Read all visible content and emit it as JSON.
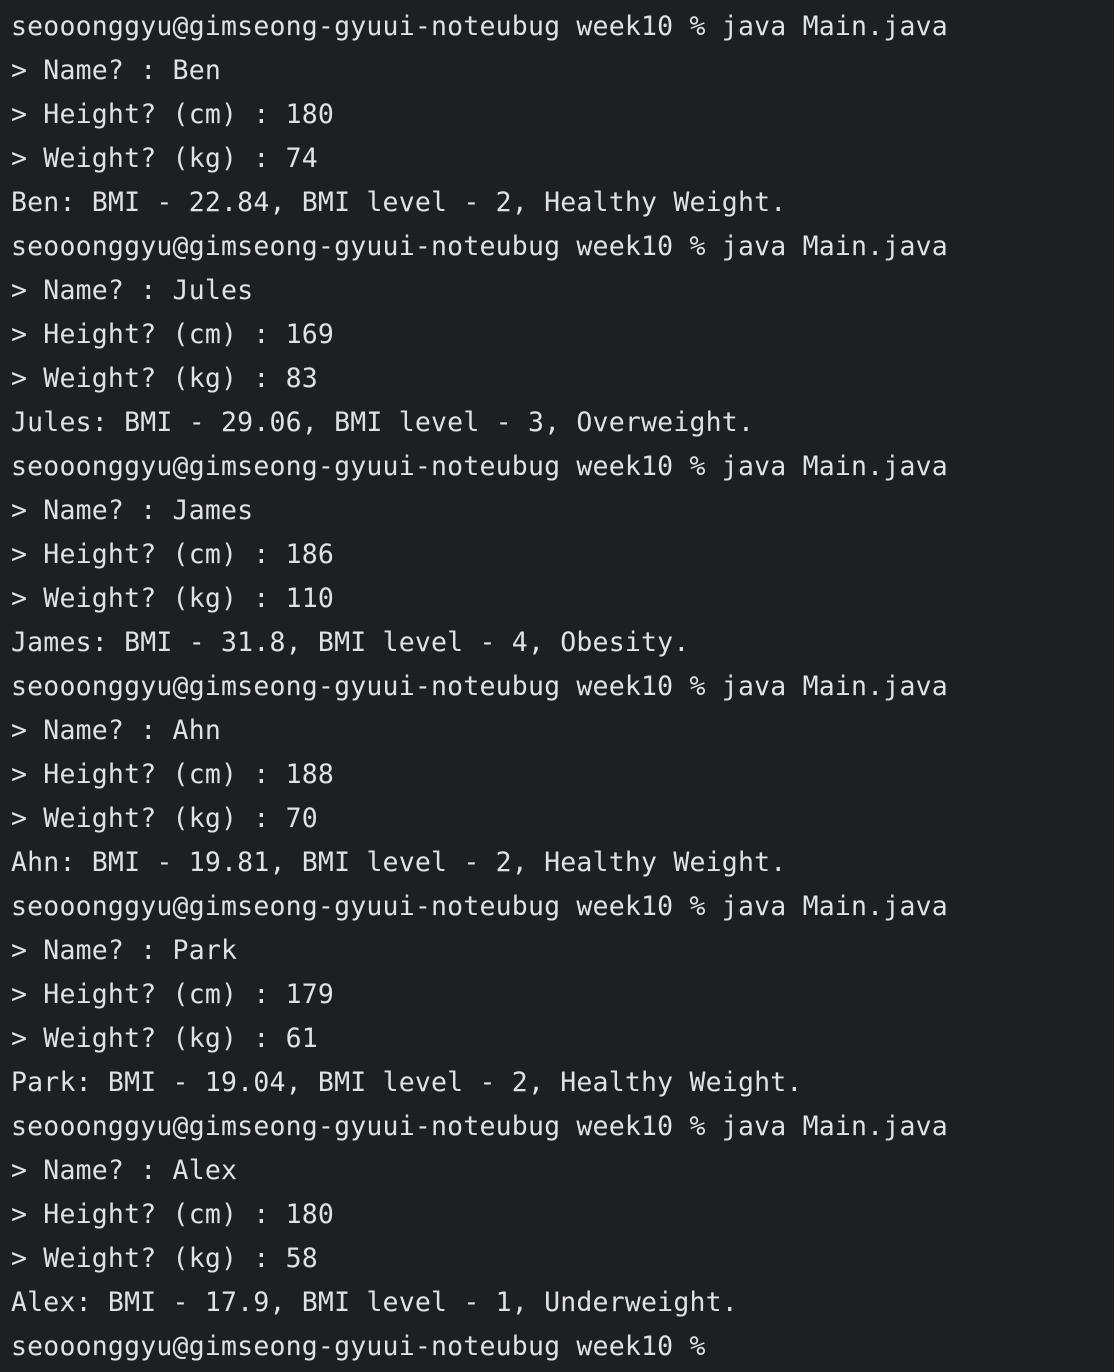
{
  "terminal": {
    "lines": [
      "seooonggyu@gimseong-gyuui-noteubug week10 % java Main.java",
      "> Name? : Ben",
      "> Height? (cm) : 180",
      "> Weight? (kg) : 74",
      "Ben: BMI - 22.84, BMI level - 2, Healthy Weight.",
      "seooonggyu@gimseong-gyuui-noteubug week10 % java Main.java",
      "> Name? : Jules",
      "> Height? (cm) : 169",
      "> Weight? (kg) : 83",
      "Jules: BMI - 29.06, BMI level - 3, Overweight.",
      "seooonggyu@gimseong-gyuui-noteubug week10 % java Main.java",
      "> Name? : James",
      "> Height? (cm) : 186",
      "> Weight? (kg) : 110",
      "James: BMI - 31.8, BMI level - 4, Obesity.",
      "seooonggyu@gimseong-gyuui-noteubug week10 % java Main.java",
      "> Name? : Ahn",
      "> Height? (cm) : 188",
      "> Weight? (kg) : 70",
      "Ahn: BMI - 19.81, BMI level - 2, Healthy Weight.",
      "seooonggyu@gimseong-gyuui-noteubug week10 % java Main.java",
      "> Name? : Park",
      "> Height? (cm) : 179",
      "> Weight? (kg) : 61",
      "Park: BMI - 19.04, BMI level - 2, Healthy Weight.",
      "seooonggyu@gimseong-gyuui-noteubug week10 % java Main.java",
      "> Name? : Alex",
      "> Height? (cm) : 180",
      "> Weight? (kg) : 58",
      "Alex: BMI - 17.9, BMI level - 1, Underweight.",
      "seooonggyu@gimseong-gyuui-noteubug week10 %"
    ],
    "background_color": "#1e1f22",
    "text_color": "#dfe1e5"
  }
}
